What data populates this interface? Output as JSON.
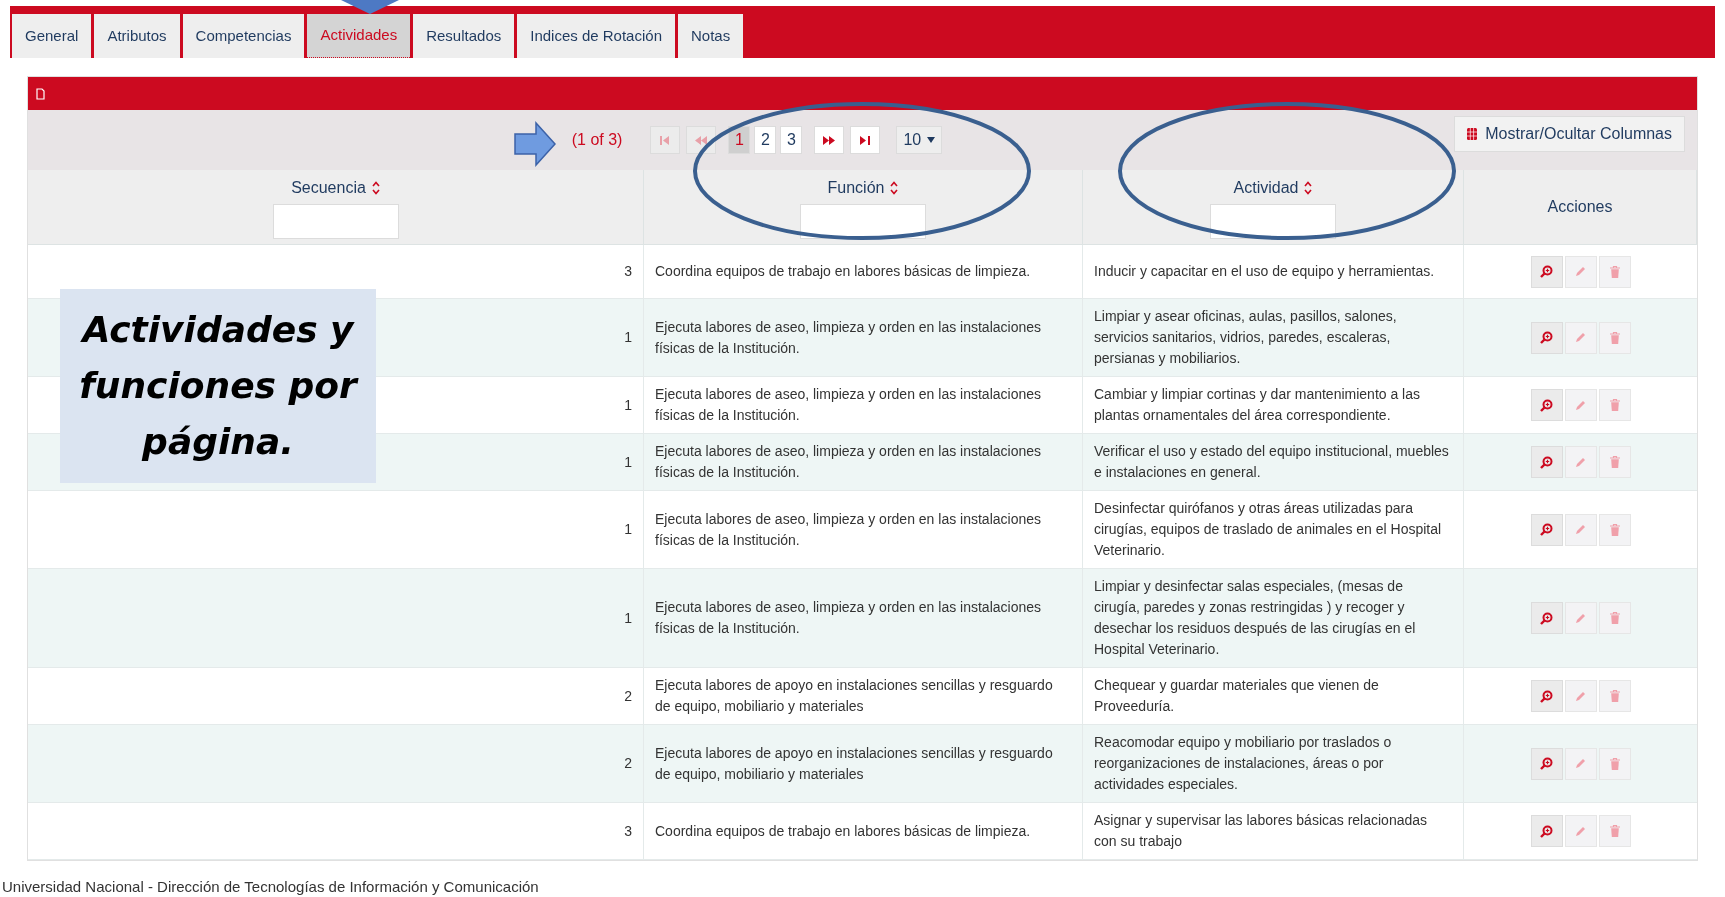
{
  "tabs": [
    {
      "label": "General",
      "selected": false
    },
    {
      "label": "Atributos",
      "selected": false
    },
    {
      "label": "Competencias",
      "selected": false
    },
    {
      "label": "Actividades",
      "selected": true
    },
    {
      "label": "Resultados",
      "selected": false
    },
    {
      "label": "Indices de Rotación",
      "selected": false
    },
    {
      "label": "Notas",
      "selected": false
    }
  ],
  "paginator": {
    "summary": "(1 of 3)",
    "nav_start": [
      {
        "kind": "first",
        "disabled": true
      },
      {
        "kind": "prev",
        "disabled": true
      }
    ],
    "pages": [
      {
        "label": "1",
        "selected": true
      },
      {
        "label": "2",
        "selected": false
      },
      {
        "label": "3",
        "selected": false
      }
    ],
    "nav_end": [
      {
        "kind": "next",
        "disabled": false
      },
      {
        "kind": "last",
        "disabled": false
      }
    ],
    "page_size": "10"
  },
  "columns_button": "Mostrar/Ocultar Columnas",
  "columns": [
    {
      "label": "Secuencia",
      "sortable": true
    },
    {
      "label": "Función",
      "sortable": true
    },
    {
      "label": "Actividad",
      "sortable": true
    },
    {
      "label": "Acciones",
      "sortable": false
    }
  ],
  "rows": [
    {
      "secuencia": "3",
      "funcion": "Coordina equipos de trabajo en labores básicas de limpieza.",
      "actividad": "Inducir y capacitar en el uso de equipo y herramientas."
    },
    {
      "secuencia": "1",
      "funcion": "Ejecuta labores de aseo, limpieza y orden en las instalaciones físicas de la Institución.",
      "actividad": "Limpiar y asear oficinas, aulas, pasillos, salones, servicios sanitarios, vidrios, paredes, escaleras, persianas y mobiliarios."
    },
    {
      "secuencia": "1",
      "funcion": "Ejecuta labores de aseo, limpieza y orden en las instalaciones físicas de la Institución.",
      "actividad": "Cambiar y limpiar cortinas y dar mantenimiento a las plantas ornamentales del área correspondiente."
    },
    {
      "secuencia": "1",
      "funcion": "Ejecuta labores de aseo, limpieza y orden en las instalaciones físicas de la Institución.",
      "actividad": "Verificar el uso y estado del equipo institucional, muebles e instalaciones en general."
    },
    {
      "secuencia": "1",
      "funcion": "Ejecuta labores de aseo, limpieza y orden en las instalaciones físicas de la Institución.",
      "actividad": "Desinfectar quirófanos y otras áreas utilizadas para cirugías, equipos de traslado de animales en el Hospital Veterinario."
    },
    {
      "secuencia": "1",
      "funcion": "Ejecuta labores de aseo, limpieza y orden en las instalaciones físicas de la Institución.",
      "actividad": "Limpiar y desinfectar salas especiales, (mesas de cirugía, paredes y zonas restringidas ) y recoger y desechar los residuos después de las cirugías en el Hospital Veterinario."
    },
    {
      "secuencia": "2",
      "funcion": "Ejecuta labores de apoyo en instalaciones sencillas y resguardo de equipo, mobiliario y materiales",
      "actividad": "Chequear y guardar materiales que vienen de Proveeduría."
    },
    {
      "secuencia": "2",
      "funcion": "Ejecuta labores de apoyo en instalaciones sencillas y resguardo de equipo, mobiliario y materiales",
      "actividad": "Reacomodar equipo y mobiliario por traslados o reorganizaciones de instalaciones, áreas o por actividades especiales."
    },
    {
      "secuencia": "3",
      "funcion": "Coordina equipos de trabajo en labores básicas de limpieza.",
      "actividad": "Asignar y supervisar las labores básicas relacionadas con su trabajo"
    }
  ],
  "callout": "Actividades y funciones por página.",
  "footer": "Universidad Nacional - Dirección de Tecnologías de Información y Comunicación"
}
